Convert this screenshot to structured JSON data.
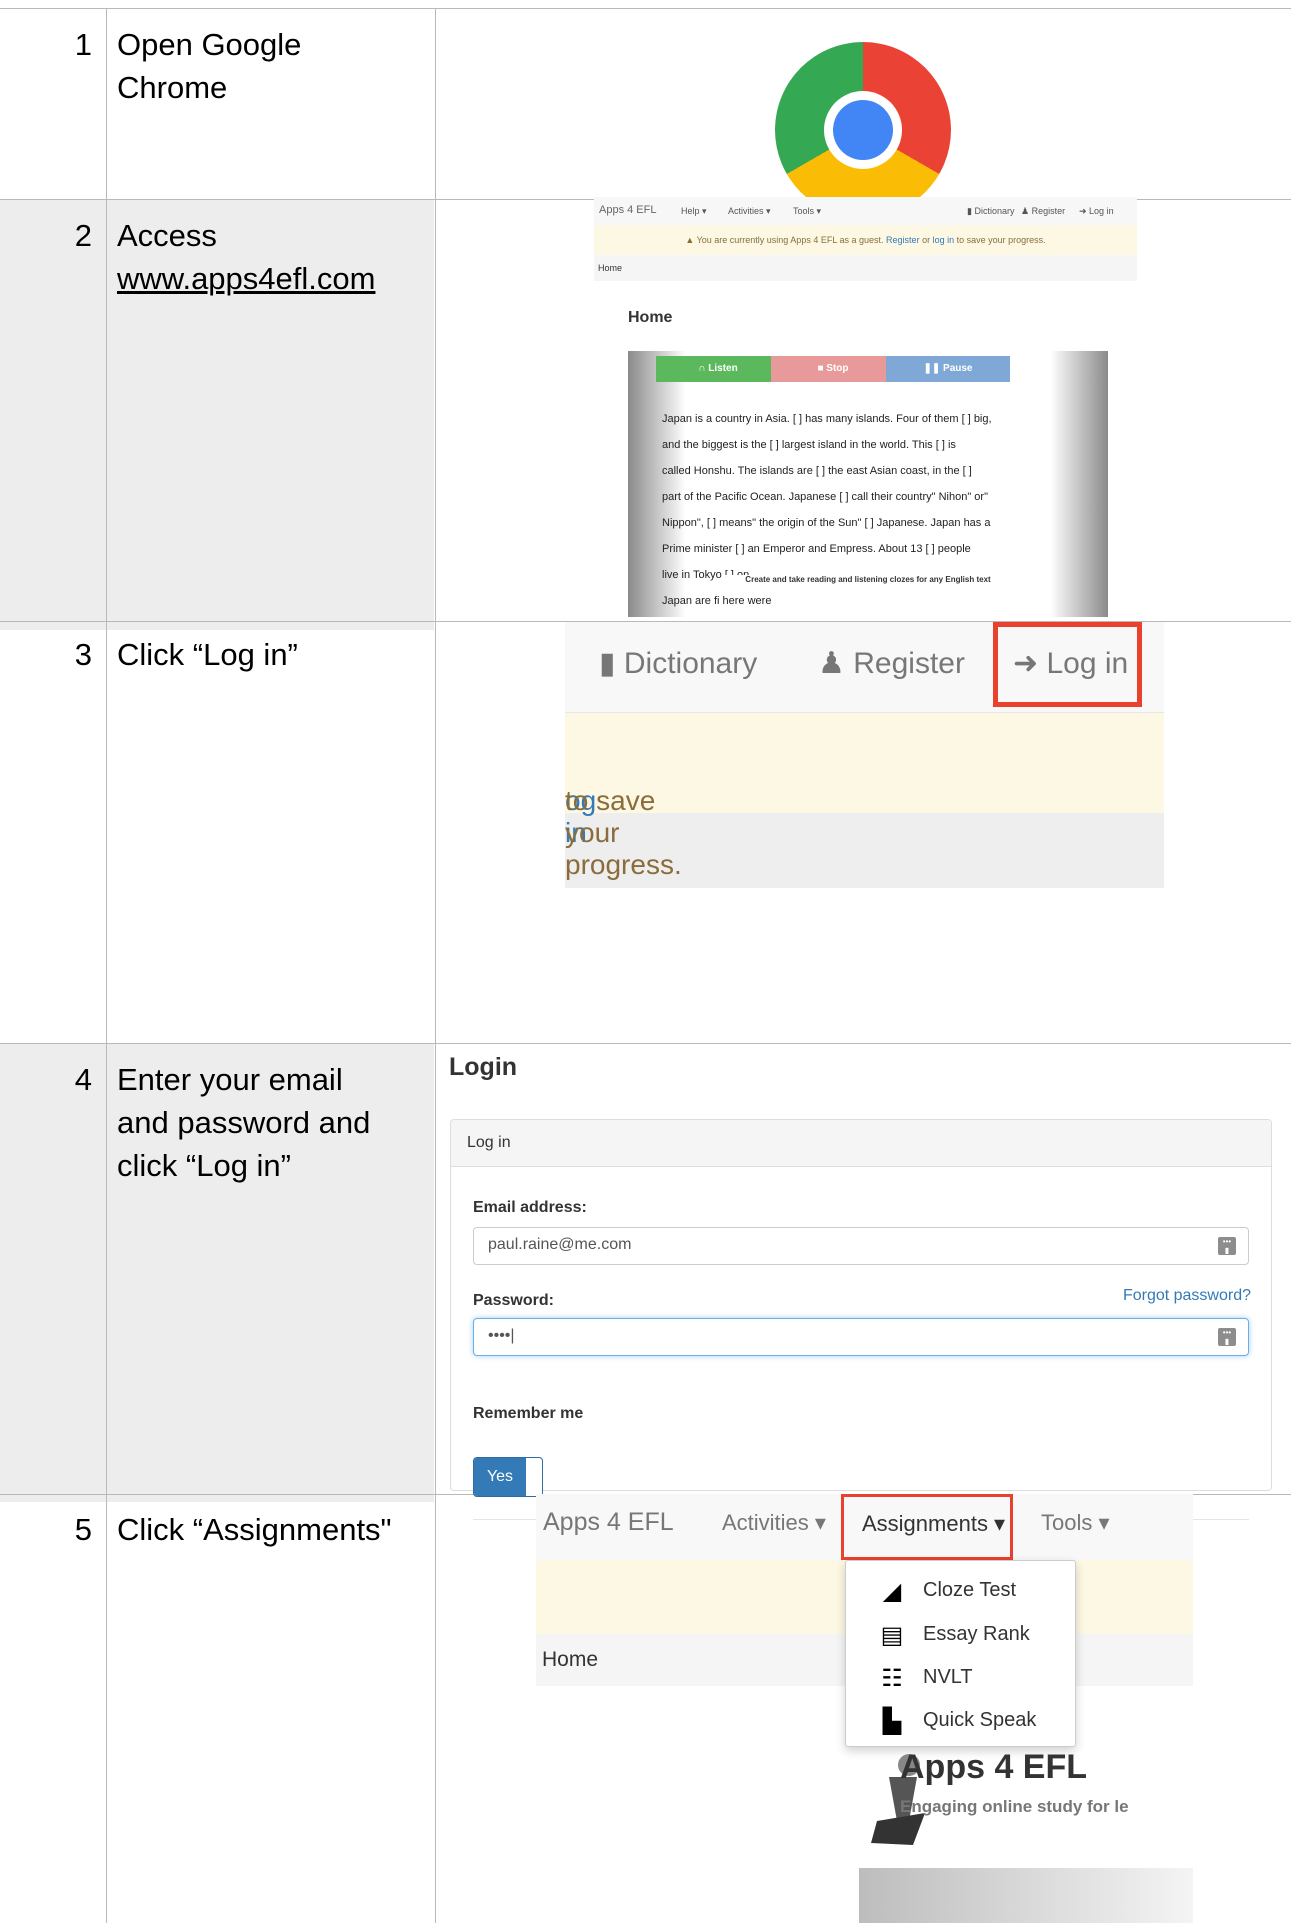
{
  "steps": [
    {
      "num": "1",
      "text_line1": "Open Google",
      "text_line2": "Chrome"
    },
    {
      "num": "2",
      "text_line1": "Access",
      "link": "www.apps4efl.com"
    },
    {
      "num": "3",
      "text": "Click “Log in”"
    },
    {
      "num": "4",
      "text_line1": "Enter your email",
      "text_line2": "and password and",
      "text_line3": "click “Log in”"
    },
    {
      "num": "5",
      "text": "Click “Assignments\""
    }
  ],
  "shot2": {
    "brand": "Apps 4 EFL",
    "nav": [
      "Help ▾",
      "Activities ▾",
      "Tools ▾"
    ],
    "nav_right": [
      "Dictionary",
      "Register",
      "Log in"
    ],
    "alert_text": "You are currently using Apps 4 EFL as a guest.",
    "alert_link1": "Register",
    "alert_or": "or",
    "alert_link2": "log in",
    "alert_end": "to save your progress.",
    "crumb": "Home",
    "heading": "Home",
    "buttons": [
      "Listen",
      "Stop",
      "Pause"
    ],
    "lines": [
      "Japan is a country in Asia. [ ] has many islands. Four of them [ ] big,",
      "and the biggest is the [ ] largest island in the world. This [ ] is",
      "called Honshu. The islands are [ ] the east Asian coast, in the [ ]",
      "part of the Pacific Ocean. Japanese [ ] call their country\" Nihon\" or\"",
      "Nippon\", [ ] means\" the origin of the Sun\" [ ] Japanese. Japan has a",
      "Prime minister [ ] an Emperor and Empress. About 13 [ ] people",
      "live in Tokyo [ ] on",
      "Japan are fi                                                            here were"
    ],
    "caption": "Create and take reading and listening clozes for any English text"
  },
  "shot3": {
    "nav": [
      "Dictionary",
      "Register",
      "Log in"
    ],
    "alert_link": "og in",
    "alert_text": "to save your progress."
  },
  "shot4": {
    "title": "Login",
    "panel_title": "Log in",
    "email_label": "Email address:",
    "email_value": "paul.raine@me.com",
    "password_label": "Password:",
    "forgot": "Forgot password?",
    "password_value": "••••|",
    "remember_label": "Remember me",
    "toggle": "Yes"
  },
  "shot5": {
    "brand": "Apps 4 EFL",
    "activities": "Activities ▾",
    "assignments": "Assignments ▾",
    "tools": "Tools ▾",
    "crumb": "Home",
    "menu": [
      "Cloze Test",
      "Essay Rank",
      "NVLT",
      "Quick Speak"
    ],
    "logo_title": "Apps 4 EFL",
    "logo_sub": "Engaging online study for le"
  },
  "colors": {
    "grid": "#b9b9b9",
    "left_shade": "#ededed",
    "highlight": "#e8412d",
    "link": "#337ab7",
    "alert_bg": "#fcf8e3"
  }
}
